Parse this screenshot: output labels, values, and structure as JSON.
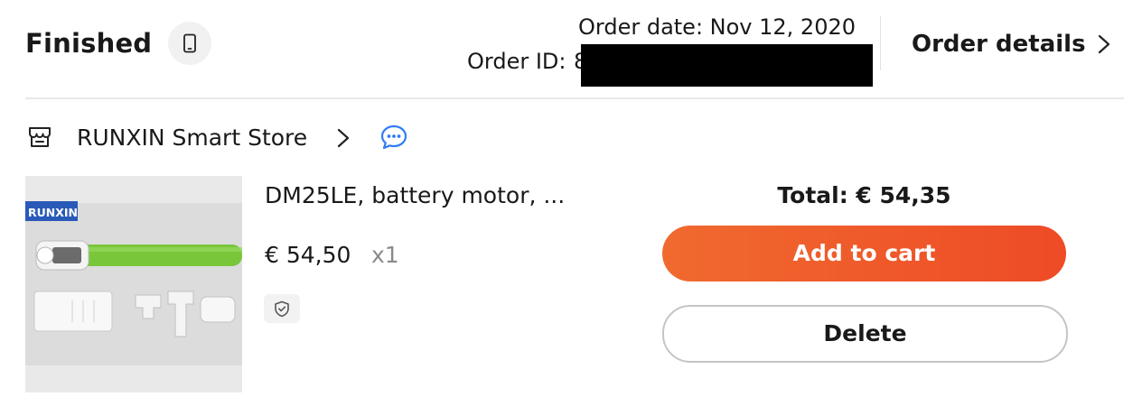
{
  "order": {
    "status": "Finished",
    "date_text": "Order date: Nov 12, 2020",
    "id_label": "Order ID:",
    "id_visible": "8",
    "details_label": "Order details"
  },
  "store": {
    "name": "RUNXIN Smart Store"
  },
  "product": {
    "image_brand_text": "RUNXIN",
    "name": "DM25LE, battery motor, ...",
    "price": "€ 54,50",
    "quantity": "x1"
  },
  "summary": {
    "total_text": "Total: € 54,35"
  },
  "actions": {
    "add_to_cart_label": "Add to cart",
    "delete_label": "Delete"
  },
  "icons": {
    "phone": "mobile-phone-icon",
    "details_chevron": "chevron-right-icon",
    "store": "store-icon",
    "store_chevron": "chevron-right-icon",
    "chat": "chat-bubble-icon",
    "badge": "shield-check-icon"
  },
  "colors": {
    "cart_gradient_start": "#f06a2f",
    "cart_gradient_end": "#ee4b26",
    "chat_blue": "#2f7df6",
    "tube_green": "#79c63a",
    "text_primary": "#191919",
    "text_muted": "#8a8a8a"
  }
}
